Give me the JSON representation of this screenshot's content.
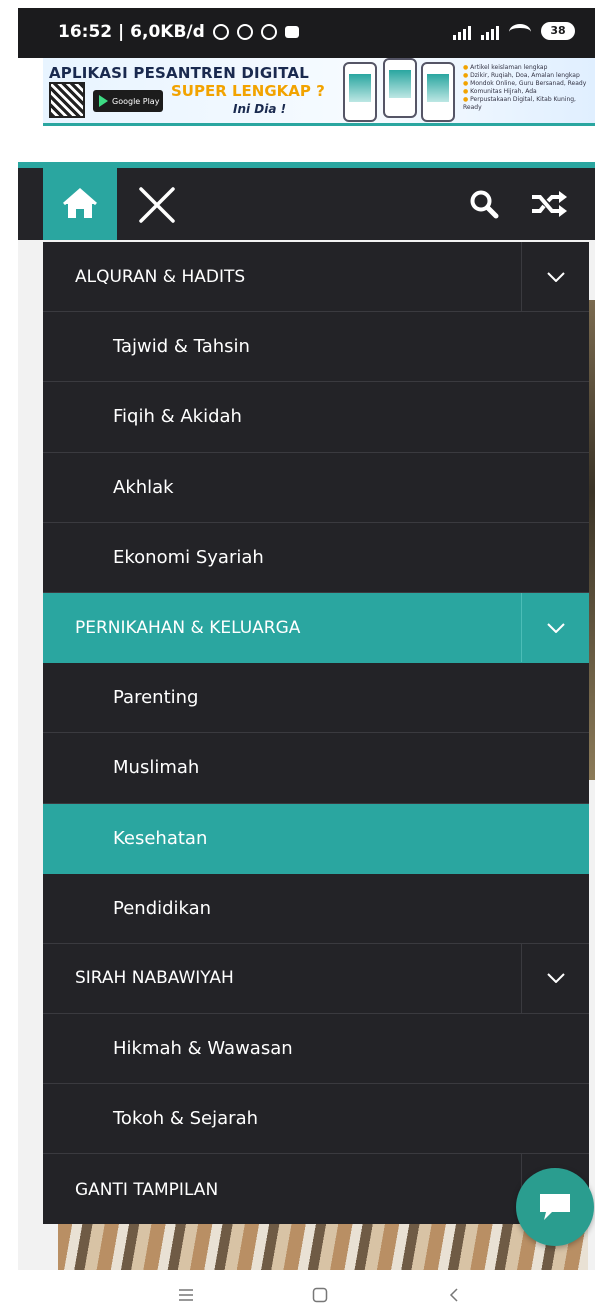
{
  "status": {
    "time_speed": "16:52 | 6,0KB/d",
    "battery": "38"
  },
  "banner": {
    "title": "APLIKASI PESANTREN DIGITAL",
    "store": "Google Play",
    "store_caption": "GET IT ON",
    "subtitle": "SUPER LENGKAP ?",
    "cta": "Ini Dia !",
    "features": [
      "Artikel keislaman lengkap",
      "Dzikir, Ruqiah, Doa, Amalan lengkap",
      "Mondok Online, Guru Bersanad, Ready",
      "Komunitas Hijrah, Ada",
      "Perpustakaan Digital, Kitab Kuning, Ready"
    ]
  },
  "navbar": {
    "home_icon": "home-icon",
    "close_icon": "close-icon",
    "search_icon": "search-icon",
    "shuffle_icon": "shuffle-icon"
  },
  "menu": {
    "items": [
      {
        "label": "ALQURAN & HADITS",
        "level": "top",
        "has_children": true,
        "active": false
      },
      {
        "label": "Tajwid & Tahsin",
        "level": "sub",
        "active": false
      },
      {
        "label": "Fiqih & Akidah",
        "level": "sub",
        "active": false
      },
      {
        "label": "Akhlak",
        "level": "sub",
        "active": false
      },
      {
        "label": "Ekonomi Syariah",
        "level": "sub",
        "active": false
      },
      {
        "label": "PERNIKAHAN & KELUARGA",
        "level": "top",
        "has_children": true,
        "active": true
      },
      {
        "label": "Parenting",
        "level": "sub",
        "active": false
      },
      {
        "label": "Muslimah",
        "level": "sub",
        "active": false
      },
      {
        "label": "Kesehatan",
        "level": "sub",
        "active": true
      },
      {
        "label": "Pendidikan",
        "level": "sub",
        "active": false
      },
      {
        "label": "SIRAH NABAWIYAH",
        "level": "top",
        "has_children": true,
        "active": false
      },
      {
        "label": "Hikmah & Wawasan",
        "level": "sub",
        "active": false
      },
      {
        "label": "Tokoh & Sejarah",
        "level": "sub",
        "active": false
      },
      {
        "label": "GANTI TAMPILAN",
        "level": "top",
        "has_children": false,
        "active": false
      }
    ]
  },
  "colors": {
    "accent": "#2aa6a0",
    "menu_bg": "#232327",
    "navbar_bg": "#242428"
  },
  "system_nav": {
    "menu_icon": "menu-lines-icon",
    "home_icon": "square-home-icon",
    "back_icon": "back-chevron-icon"
  }
}
